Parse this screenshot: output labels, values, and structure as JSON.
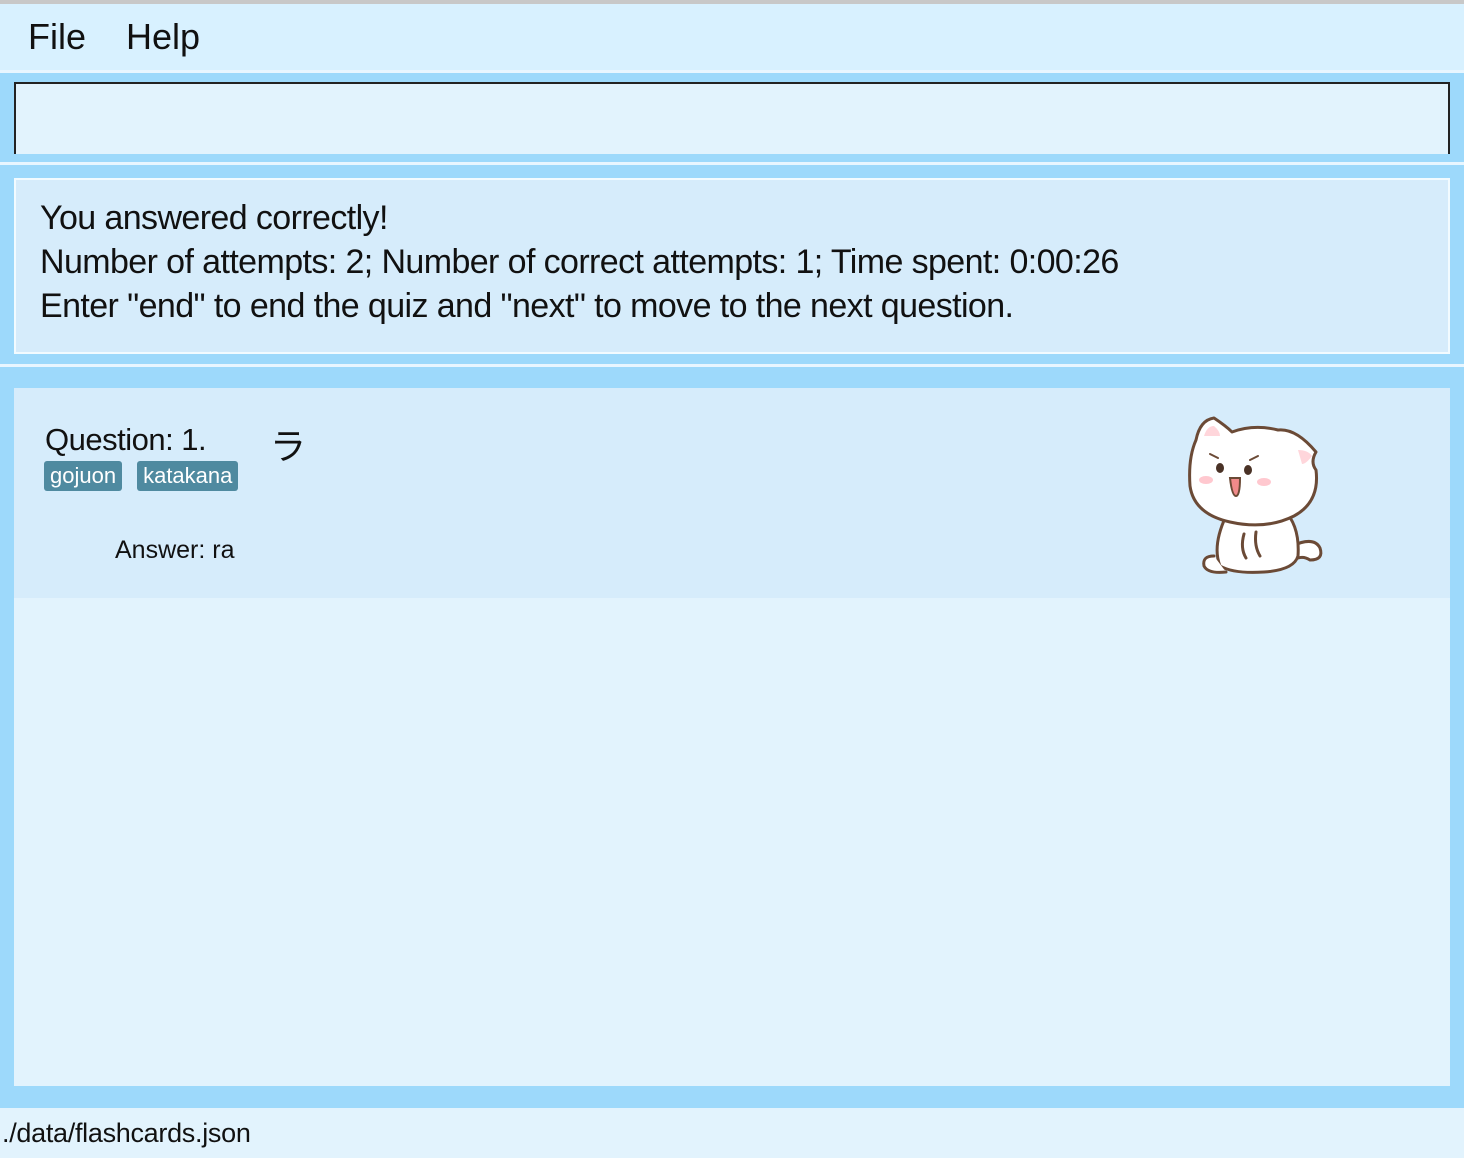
{
  "menu": {
    "items": [
      "File",
      "Help"
    ]
  },
  "command": {
    "value": "",
    "placeholder": ""
  },
  "result": {
    "lines": [
      "You answered correctly!",
      "Number of attempts: 2; Number of correct attempts: 1; Time spent: 0:00:26",
      "Enter \"end\" to end the quiz and \"next\" to move to the next question."
    ]
  },
  "card": {
    "question_label": "Question: 1.",
    "question_text": "ラ",
    "tags": [
      "gojuon",
      "katakana"
    ],
    "answer": "Answer: ra",
    "image": "cute-white-cat-sticker"
  },
  "status": {
    "file_path": "./data/flashcards.json"
  },
  "colors": {
    "background": "#9dd9fb",
    "menubar": "#d8f1ff",
    "panel": "#d6ecfb",
    "tag": "#4f8aa0"
  }
}
